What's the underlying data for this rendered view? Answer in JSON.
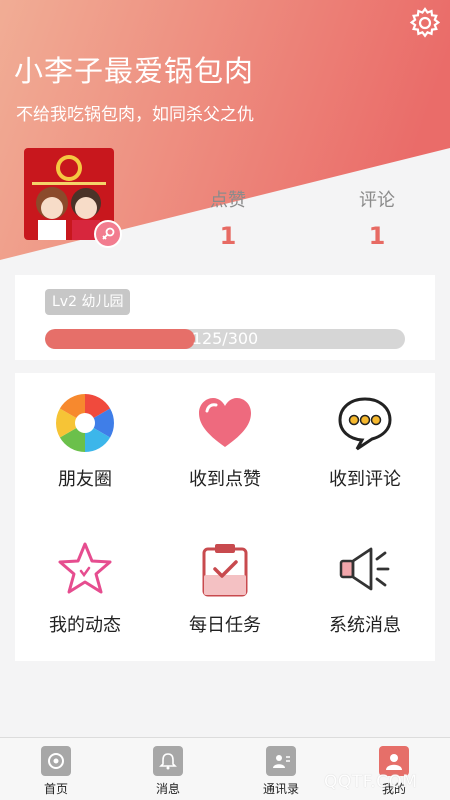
{
  "profile": {
    "name": "小李子最爱锅包肉",
    "motto": "不给我吃锅包肉，如同杀父之仇",
    "avatar_alt": "avatar",
    "gender_icon": "female-icon"
  },
  "stats": {
    "likes_label": "点赞",
    "likes_value": "1",
    "comments_label": "评论",
    "comments_value": "1"
  },
  "level": {
    "tag": "Lv2 幼儿园",
    "progress_text": "125/300",
    "progress_fraction": 0.4167
  },
  "grid": {
    "items": [
      {
        "label": "朋友圈",
        "icon": "aperture-icon"
      },
      {
        "label": "收到点赞",
        "icon": "heart-icon"
      },
      {
        "label": "收到评论",
        "icon": "chat-bubble-icon"
      },
      {
        "label": "我的动态",
        "icon": "star-icon"
      },
      {
        "label": "每日任务",
        "icon": "clipboard-check-icon"
      },
      {
        "label": "系统消息",
        "icon": "megaphone-icon"
      }
    ]
  },
  "tabbar": {
    "items": [
      {
        "label": "首页",
        "icon": "home-icon"
      },
      {
        "label": "消息",
        "icon": "bell-icon"
      },
      {
        "label": "通讯录",
        "icon": "contacts-icon"
      },
      {
        "label": "我的",
        "icon": "person-icon"
      }
    ],
    "active_index": 3
  },
  "watermark": "QQTF.COM",
  "colors": {
    "accent": "#e66f69",
    "header_start": "#f1a68f",
    "header_end": "#ea6d6a"
  }
}
